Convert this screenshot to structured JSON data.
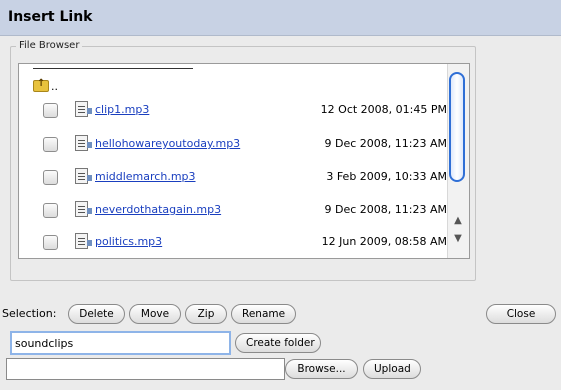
{
  "window": {
    "title": "Insert Link"
  },
  "file_browser": {
    "legend": "File Browser",
    "up_dir_label": "..",
    "files": [
      {
        "name": "clip1.mp3",
        "date": "12 Oct 2008, 01:45 PM"
      },
      {
        "name": "hellohowareyoutoday.mp3",
        "date": "9 Dec 2008, 11:23 AM"
      },
      {
        "name": "middlemarch.mp3",
        "date": "3 Feb 2009, 10:33 AM"
      },
      {
        "name": "neverdothatagain.mp3",
        "date": "9 Dec 2008, 11:23 AM"
      },
      {
        "name": "politics.mp3",
        "date": "12 Jun 2009, 08:58 AM"
      }
    ]
  },
  "selection": {
    "label": "Selection:",
    "delete_label": "Delete",
    "move_label": "Move",
    "zip_label": "Zip",
    "rename_label": "Rename"
  },
  "close_label": "Close",
  "folder": {
    "name_value": "soundclips",
    "create_label": "Create folder"
  },
  "upload": {
    "file_value": "",
    "browse_label": "Browse...",
    "upload_label": "Upload"
  },
  "icons": {
    "up_folder": "folder-up-icon",
    "file": "audio-file-icon"
  }
}
